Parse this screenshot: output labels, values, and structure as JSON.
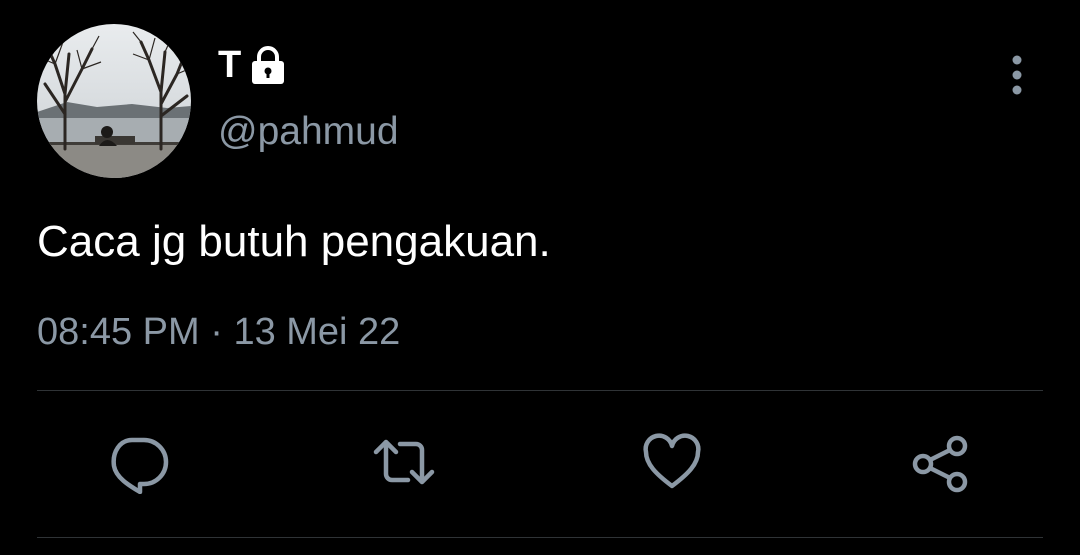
{
  "author": {
    "display_name": "T",
    "handle": "@pahmud",
    "protected": true
  },
  "tweet": {
    "text": "Caca jg butuh pengakuan.",
    "time": "08:45 PM",
    "separator": "·",
    "date": "13 Mei 22"
  },
  "actions": [
    {
      "icon": "reply-icon"
    },
    {
      "icon": "retweet-icon"
    },
    {
      "icon": "like-icon"
    },
    {
      "icon": "share-icon"
    }
  ],
  "colors": {
    "background": "#000000",
    "primary_text": "#ffffff",
    "secondary_text": "#8b98a5",
    "icon": "#8b98a5",
    "divider": "#2f3336"
  }
}
